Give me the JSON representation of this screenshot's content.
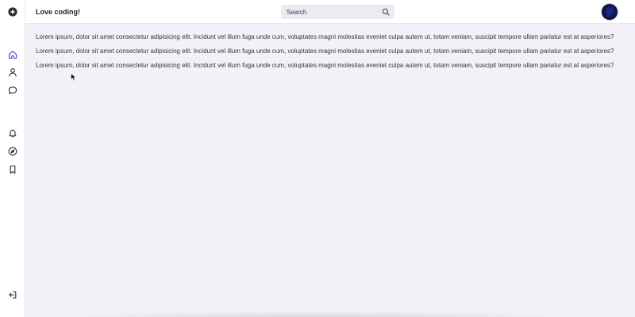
{
  "header": {
    "title": "Love coding!",
    "search": {
      "placeholder": "Search",
      "value": ""
    }
  },
  "sidebar": {
    "items": [
      {
        "icon": "logo-icon"
      },
      {
        "icon": "home-icon",
        "active": true
      },
      {
        "icon": "user-icon"
      },
      {
        "icon": "message-icon"
      },
      {
        "icon": "bell-icon"
      },
      {
        "icon": "compass-icon"
      },
      {
        "icon": "bookmark-icon"
      },
      {
        "icon": "logout-icon"
      }
    ]
  },
  "main": {
    "paragraphs": [
      "Lorem ipsum, dolor sit amet consectetur adipisicing elit. Incidunt vel illum fuga unde cum, voluptates magni molestias eveniet culpa autem ut, totam veniam, suscipit tempore ullam pariatur est at asperiores?",
      "Lorem ipsum, dolor sit amet consectetur adipisicing elit. Incidunt vel illum fuga unde cum, voluptates magni molestias eveniet culpa autem ut, totam veniam, suscipit tempore ullam pariatur est at asperiores?",
      "Lorem ipsum, dolor sit amet consectetur adipisicing elit. Incidunt vel illum fuga unde cum, voluptates magni molestias eveniet culpa autem ut, totam veniam, suscipit tempore ullam pariatur est at asperiores?"
    ]
  },
  "colors": {
    "background": "#f3f1f7",
    "panel": "#ffffff",
    "accent": "#5b3fd6",
    "icon": "#2e2e36",
    "search_bg": "#ecebf2"
  }
}
